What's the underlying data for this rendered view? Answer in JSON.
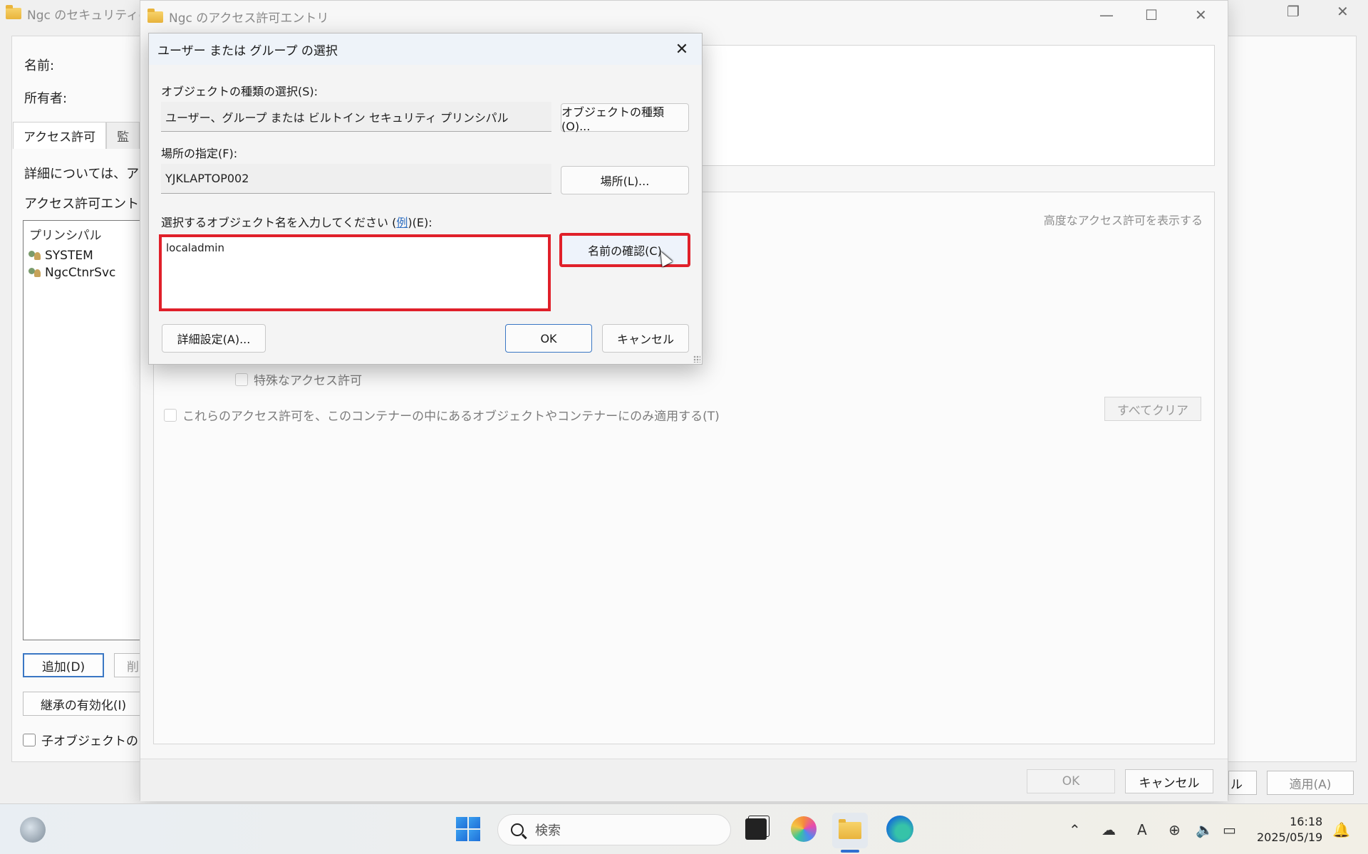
{
  "back_window": {
    "title": "Ngc のセキュリティの詳",
    "name_label": "名前:",
    "owner_label": "所有者:",
    "tabs": [
      "アクセス許可",
      "監"
    ],
    "info_text": "詳細については、アク",
    "entries_label": "アクセス許可エントリ:",
    "list_header": "プリンシパル",
    "list_items": [
      "SYSTEM",
      "NgcCtnrSvc"
    ],
    "add_button": "追加(D)",
    "remove_button": "削",
    "inherit_button": "継承の有効化(I)",
    "child_checkbox": "子オブジェクトのア",
    "apply_button": "適用(A)",
    "cancel_partial": "ル"
  },
  "middle_window": {
    "title": "Ngc のアクセス許可エントリ",
    "advanced_link": "高度なアクセス許可を表示する",
    "special_permission": "特殊なアクセス許可",
    "apply_container_text": "これらのアクセス許可を、このコンテナーの中にあるオブジェクトやコンテナーにのみ適用する(T)",
    "clear_all": "すべてクリア",
    "ok": "OK",
    "cancel": "キャンセル"
  },
  "dialog": {
    "title": "ユーザー または グループ の選択",
    "object_type_label": "オブジェクトの種類の選択(S):",
    "object_type_value": "ユーザー、グループ または ビルトイン セキュリティ プリンシパル",
    "object_type_button": "オブジェクトの種類(O)...",
    "location_label": "場所の指定(F):",
    "location_value": "YJKLAPTOP002",
    "location_button": "場所(L)...",
    "enter_label_prefix": "選択するオブジェクト名を入力してください (",
    "example_link": "例",
    "enter_label_suffix": ")(E):",
    "name_input_value": "localadmin",
    "check_names_button": "名前の確認(C)",
    "advanced_button": "詳細設定(A)...",
    "ok_button": "OK",
    "cancel_button": "キャンセル"
  },
  "taskbar": {
    "search_placeholder": "検索",
    "time": "16:18",
    "date": "2025/05/19"
  },
  "colors": {
    "highlight": "#e0202a",
    "accent": "#3a77c4"
  }
}
